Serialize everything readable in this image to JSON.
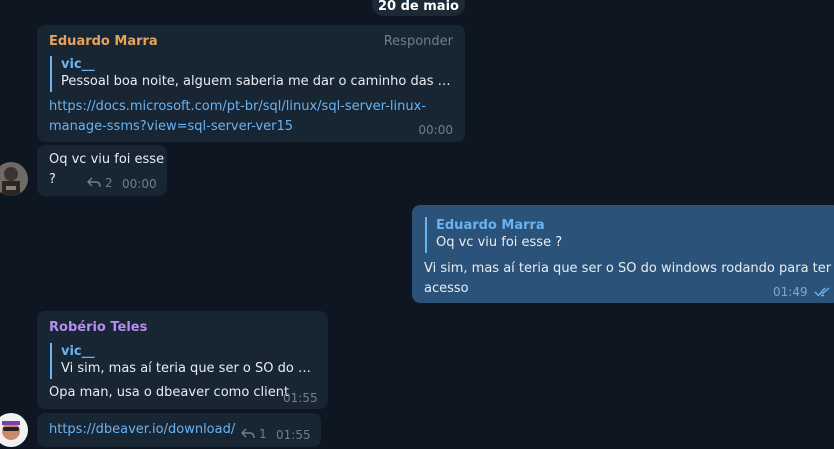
{
  "date_label": "20 de maio",
  "messages": {
    "m1": {
      "sender": "Eduardo Marra",
      "reply_label": "Responder",
      "quote_name": "vic__",
      "quote_text": "Pessoal boa noite, alguem saberia me dar o caminho das pedra...",
      "link_line1": "https://docs.microsoft.com/pt-br/sql/linux/sql-server-linux-",
      "link_line2": "manage-ssms?view=sql-server-ver15",
      "time": "00:00"
    },
    "m2": {
      "line1": "Oq vc viu foi esse",
      "line2": "?",
      "reply_count": "2",
      "time": "00:00"
    },
    "m3": {
      "quote_name": "Eduardo Marra",
      "quote_text": "Oq vc viu foi esse  ?",
      "line1": "Vi sim, mas aí teria que ser o SO do windows rodando para ter",
      "line2": "acesso",
      "time": "01:49"
    },
    "m4": {
      "sender": "Robério Teles",
      "quote_name": "vic__",
      "quote_text": "Vi sim, mas aí teria que ser o SO do wind...",
      "text": "Opa man, usa o dbeaver como client",
      "time": "01:55"
    },
    "m5": {
      "link": "https://dbeaver.io/download/",
      "reply_count": "1",
      "time": "01:55"
    }
  },
  "colors": {
    "background": "#0e1621",
    "incoming_bubble": "#182533",
    "outgoing_bubble": "#2b5278",
    "accent_link": "#6ab3f3",
    "sender_eduardo": "#e8a25c",
    "sender_roberio": "#b68cf0"
  }
}
